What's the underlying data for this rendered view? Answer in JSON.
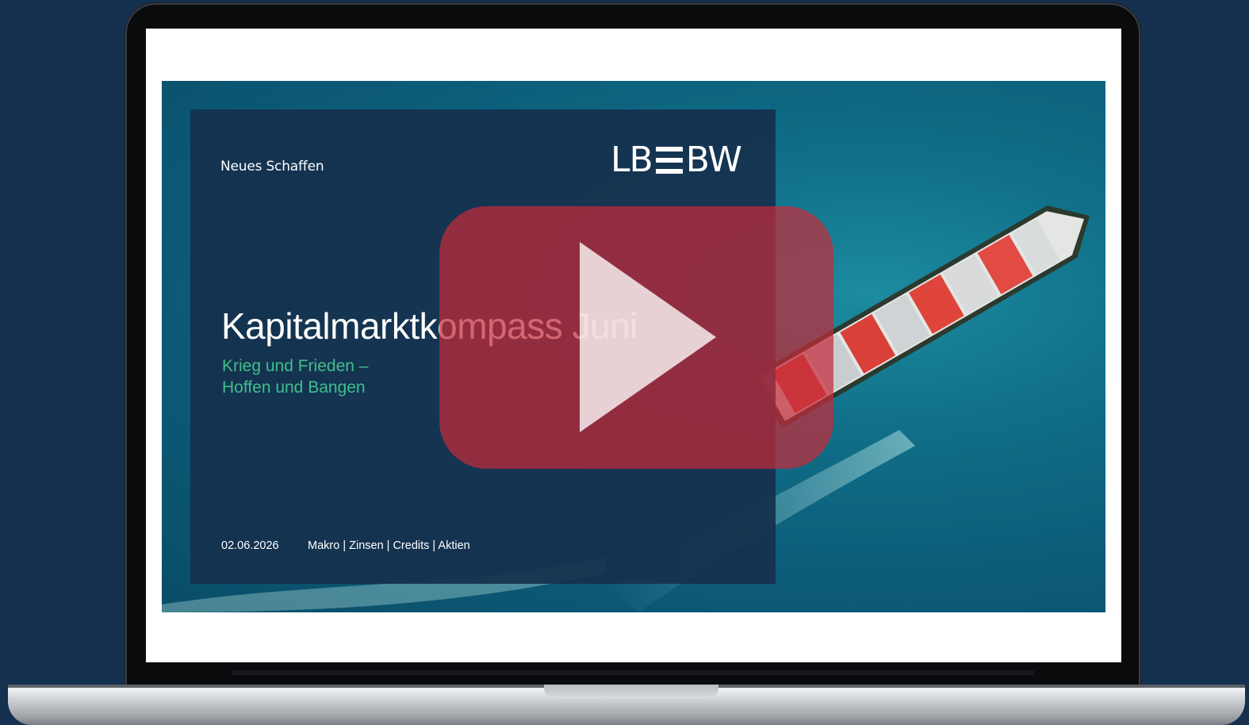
{
  "slide": {
    "tagline": "Neues Schaffen",
    "logo_left": "LB",
    "logo_right": "BW",
    "title": "Kapitalmarktkompass Juni",
    "subtitle_line1": "Krieg und Frieden –",
    "subtitle_line2": "Hoffen und Bangen",
    "date": "02.06.2026",
    "topics": "Makro | Zinsen  | Credits | Aktien"
  },
  "video": {
    "play_icon": "play-icon"
  },
  "colors": {
    "background": "#15314f",
    "panel": "#15304e",
    "subtitle": "#3fbf8c",
    "play_button": "#c42b3a"
  }
}
